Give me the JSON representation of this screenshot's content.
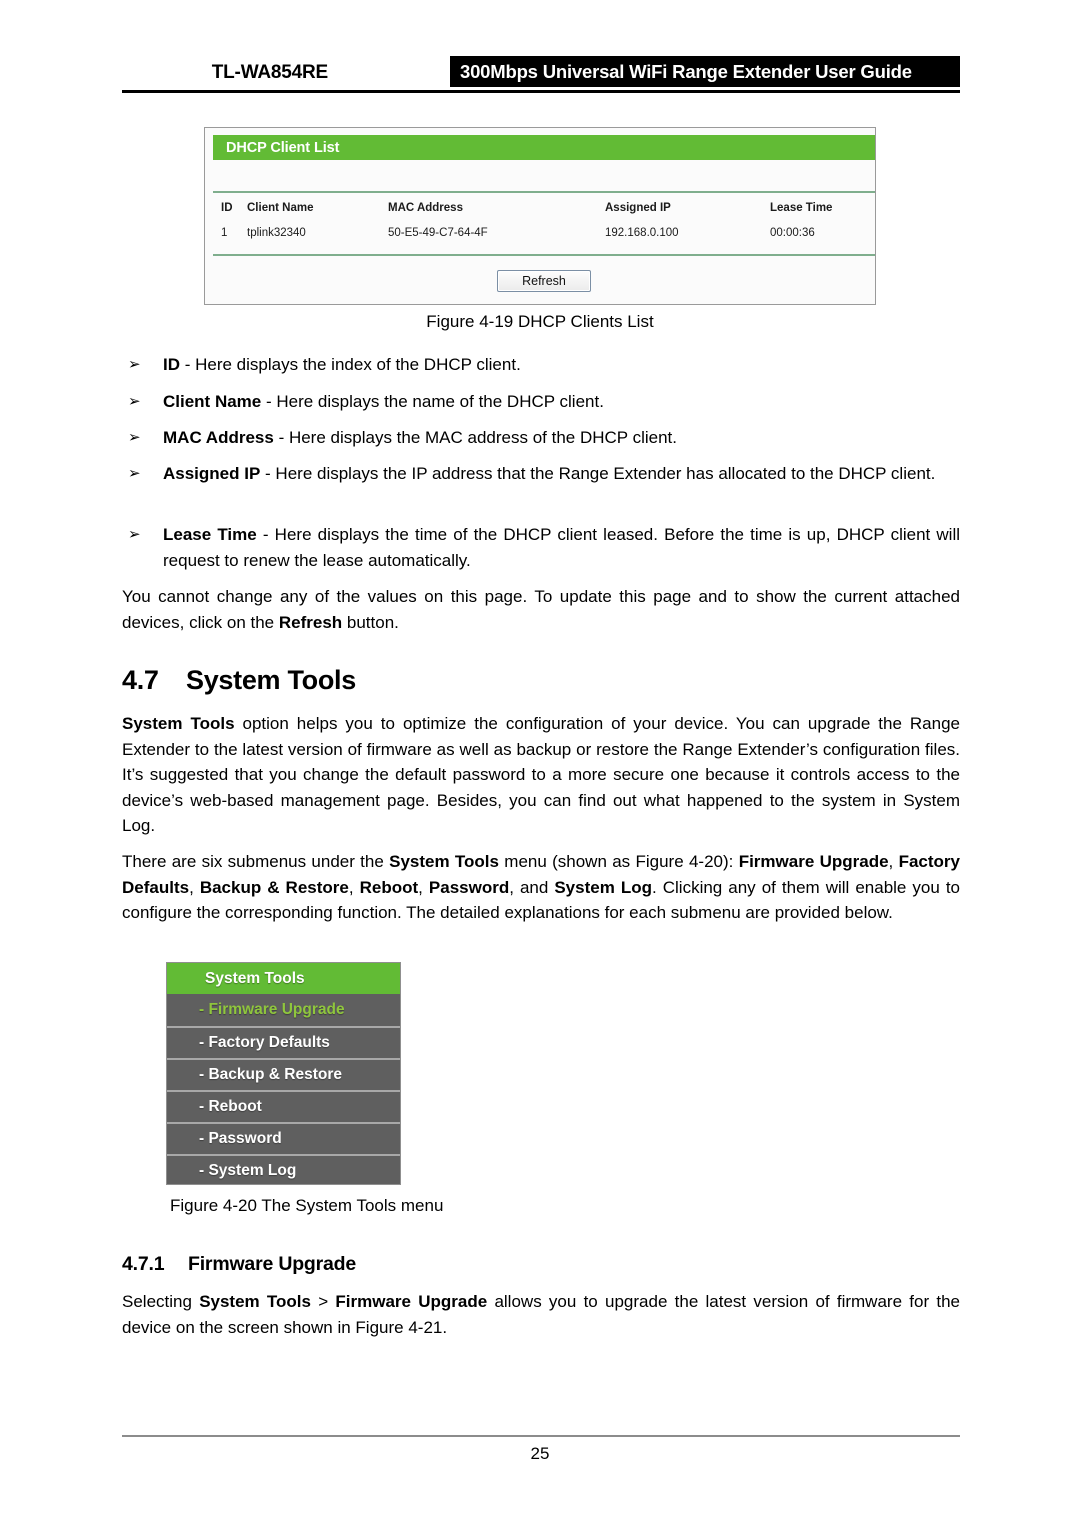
{
  "header": {
    "model": "TL-WA854RE",
    "title": "300Mbps Universal WiFi Range Extender User Guide"
  },
  "dhcp_panel": {
    "title": "DHCP Client List",
    "columns": [
      "ID",
      "Client Name",
      "MAC Address",
      "Assigned IP",
      "Lease Time"
    ],
    "rows": [
      {
        "id": "1",
        "client_name": "tplink32340",
        "mac_address": "50-E5-49-C7-64-4F",
        "assigned_ip": "192.168.0.100",
        "lease_time": "00:00:36"
      }
    ],
    "refresh_label": "Refresh",
    "header_color": "#62bb35"
  },
  "figures": {
    "fig_19_caption": "Figure 4-19 DHCP Clients List",
    "fig_20_caption": "Figure 4-20 The System Tools menu"
  },
  "bullets": {
    "glyph": "➢",
    "items": [
      {
        "term": "ID",
        "sep": " - ",
        "text": "Here displays the index of the DHCP client."
      },
      {
        "term": "Client Name",
        "sep": " - ",
        "text": "Here displays the name of the DHCP client."
      },
      {
        "term": "MAC Address",
        "sep": " - ",
        "text": "Here displays the MAC address of the DHCP client."
      },
      {
        "term": "Assigned IP",
        "sep": " - ",
        "text": "Here displays the IP address that the Range Extender has allocated to the DHCP client."
      },
      {
        "term": "Lease Time",
        "sep": " - ",
        "text": "Here displays the time of the DHCP client leased. Before the time is up, DHCP client will request to renew the lease automatically."
      }
    ]
  },
  "paragraphs": {
    "refresh_note_a": "You cannot change any of the values on this page. To update this page and to show the current attached devices, click on the ",
    "refresh_note_bold": "Refresh",
    "refresh_note_b": " button.",
    "system_tools_intro_bold": "System Tools",
    "system_tools_intro": " option helps you to optimize the configuration of your device. You can upgrade the Range Extender to the latest version of firmware as well as backup or restore the Range Extender’s configuration files. It’s suggested that you change the default password to a more secure one because it controls access to the device’s web-based management page. Besides, you can find out what happened to the system in System Log.",
    "submenus_p1": "There are six submenus under the ",
    "submenus_b1": "System Tools",
    "submenus_p2": " menu (shown as Figure 4-20): ",
    "submenus_b2": "Firmware Upgrade",
    "submenus_p3": ", ",
    "submenus_b3": "Factory Defaults",
    "submenus_p4": ", ",
    "submenus_b4": "Backup & Restore",
    "submenus_p5": ", ",
    "submenus_b5": "Reboot",
    "submenus_p6": ", ",
    "submenus_b6": "Password",
    "submenus_p7": ", and ",
    "submenus_b7": "System Log",
    "submenus_p8": ". Clicking any of them will enable you to configure the corresponding function. The detailed explanations for each submenu are provided below.",
    "firmware_p1": "Selecting ",
    "firmware_b1": "System Tools",
    "firmware_p2": " > ",
    "firmware_b2": "Firmware Upgrade",
    "firmware_p3": " allows you to upgrade the latest version of firmware for the device on the screen shown in Figure 4-21."
  },
  "headings": {
    "section_number": "4.7",
    "section_title": "System Tools",
    "subsection_number": "4.7.1",
    "subsection_title": "Firmware Upgrade"
  },
  "system_tools_menu": {
    "header": "System Tools",
    "items": [
      {
        "label": "- Firmware Upgrade",
        "active": true
      },
      {
        "label": "- Factory Defaults",
        "active": false
      },
      {
        "label": "- Backup & Restore",
        "active": false
      },
      {
        "label": "- Reboot",
        "active": false
      },
      {
        "label": "- Password",
        "active": false
      },
      {
        "label": "- System Log",
        "active": false
      }
    ],
    "header_color": "#62bb35",
    "active_color": "#8fc63d",
    "background_color": "#5f5f5f"
  },
  "footer": {
    "page_number": "25"
  }
}
